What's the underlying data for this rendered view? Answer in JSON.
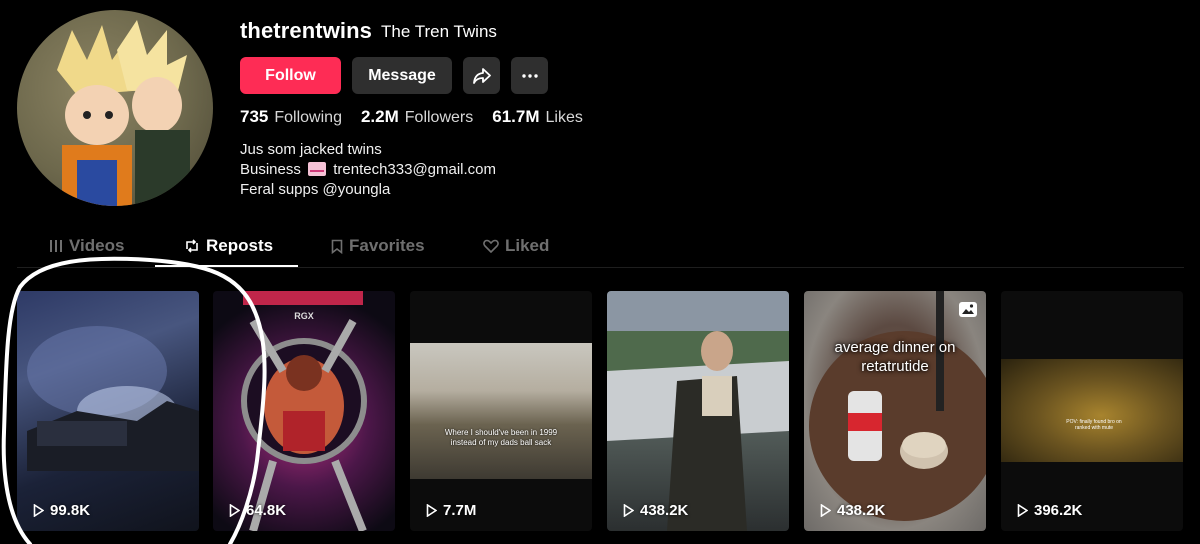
{
  "profile": {
    "username": "thetrentwins",
    "display_name": "The Tren Twins",
    "follow_label": "Follow",
    "message_label": "Message",
    "stats": [
      {
        "value": "735",
        "label": "Following"
      },
      {
        "value": "2.2M",
        "label": "Followers"
      },
      {
        "value": "61.7M",
        "label": "Likes"
      }
    ],
    "bio": {
      "line1": "Jus som jacked twins",
      "line2_prefix": "Business",
      "line2_email": "trentech333@gmail.com",
      "line3": "Feral supps @youngla"
    }
  },
  "tabs": [
    {
      "label": "Videos",
      "icon": "grid-lines-icon",
      "active": false
    },
    {
      "label": "Reposts",
      "icon": "repost-icon",
      "active": true
    },
    {
      "label": "Favorites",
      "icon": "bookmark-icon",
      "active": false
    },
    {
      "label": "Liked",
      "icon": "heart-outline-icon",
      "active": false
    }
  ],
  "videos": [
    {
      "views": "99.8K"
    },
    {
      "views": "64.8K",
      "overlay_text": "RGX"
    },
    {
      "views": "7.7M",
      "overlay_text": "Where I should've been in 1999 instead of my dads ball sack"
    },
    {
      "views": "438.2K"
    },
    {
      "views": "438.2K",
      "overlay_text": "average dinner on retatrutide"
    },
    {
      "views": "396.2K",
      "overlay_text": "POV: finally found bro on ranked with mute"
    }
  ],
  "colors": {
    "follow": "#fe2c55",
    "secondary_button": "#2f2f2f",
    "background": "#000000",
    "inactive_tab": "#6f6f6f"
  }
}
